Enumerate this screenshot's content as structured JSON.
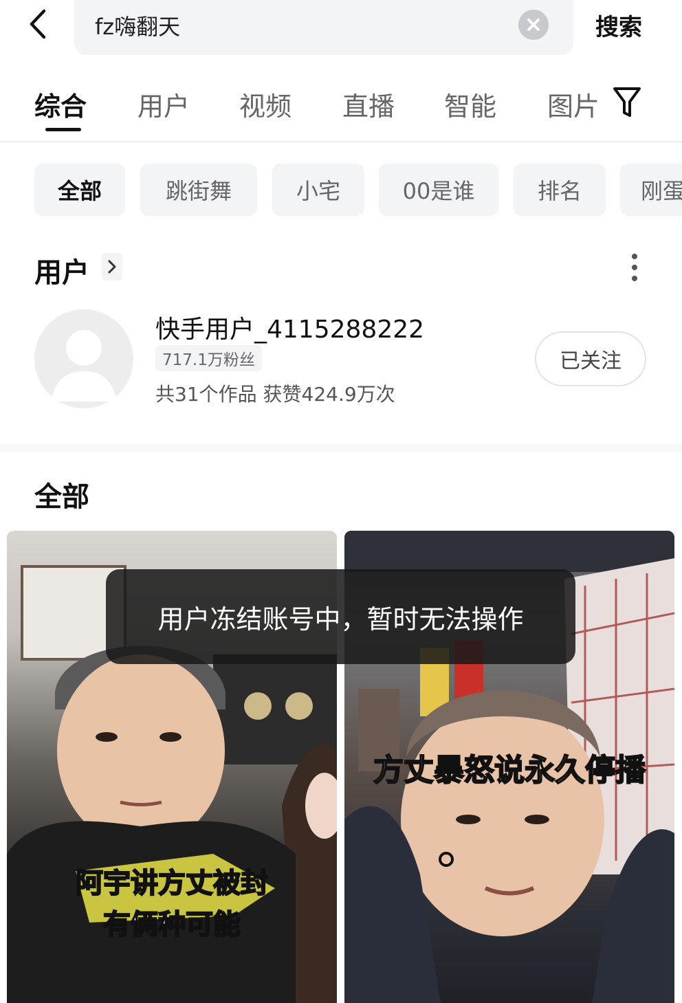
{
  "search": {
    "query": "fz嗨翻天",
    "button_label": "搜索"
  },
  "tabs": [
    {
      "label": "综合",
      "active": true
    },
    {
      "label": "用户"
    },
    {
      "label": "视频"
    },
    {
      "label": "直播"
    },
    {
      "label": "智能"
    },
    {
      "label": "图片"
    }
  ],
  "chips": [
    {
      "label": "全部",
      "active": true
    },
    {
      "label": "跳街舞"
    },
    {
      "label": "小宅"
    },
    {
      "label": "00是谁"
    },
    {
      "label": "排名"
    },
    {
      "label": "刚蛋"
    }
  ],
  "user_section": {
    "heading": "用户",
    "user": {
      "name": "快手用户_4115288222",
      "fans": "717.1万粉丝",
      "stats": "共31个作品 获赞424.9万次",
      "follow_label": "已关注"
    }
  },
  "all_section": {
    "heading": "全部"
  },
  "videos": [
    {
      "caption_line1": "阿宇讲方丈被封",
      "caption_line2": "有俩种可能"
    },
    {
      "caption": "方丈暴怒说永久停播"
    }
  ],
  "toast": {
    "message": "用户冻结账号中，暂时无法操作"
  },
  "colors": {
    "accent": "#111111",
    "chip_bg": "#f3f4f6",
    "caption_yellow": "#ffe03b"
  }
}
